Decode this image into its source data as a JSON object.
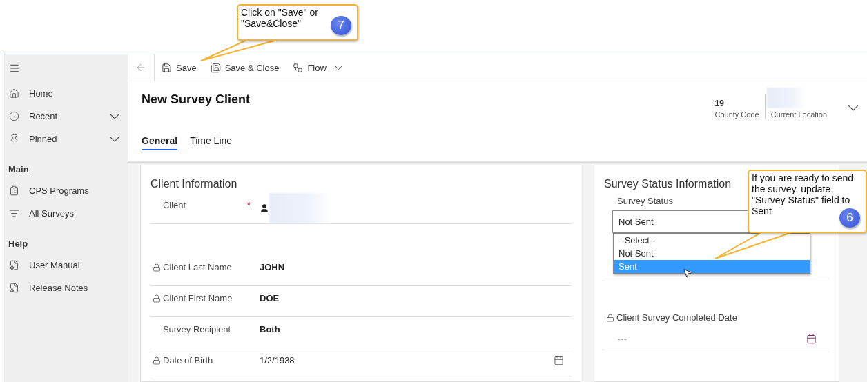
{
  "callouts": [
    {
      "text": "Click on \"Save\" or \"Save&Close\"",
      "step": "7"
    },
    {
      "text": "If you are ready to send the survey, update \"Survey Status\" field to Sent",
      "step": "6"
    }
  ],
  "sidebar": {
    "top_items": [
      {
        "label": "Home",
        "expandable": false
      },
      {
        "label": "Recent",
        "expandable": true
      },
      {
        "label": "Pinned",
        "expandable": true
      }
    ],
    "groups": [
      {
        "title": "Main",
        "items": [
          {
            "label": "CPS Programs"
          },
          {
            "label": "All Surveys"
          }
        ]
      },
      {
        "title": "Help",
        "items": [
          {
            "label": "User Manual"
          },
          {
            "label": "Release Notes"
          }
        ]
      }
    ]
  },
  "toolbar": {
    "buttons": [
      {
        "label": "Save",
        "dropdown": false
      },
      {
        "label": "Save & Close",
        "dropdown": false
      },
      {
        "label": "Flow",
        "dropdown": true
      }
    ]
  },
  "header": {
    "title": "New Survey Client",
    "fields": [
      {
        "value": "19",
        "label": "County Code"
      },
      {
        "label": "Current Location"
      }
    ]
  },
  "tabs": [
    {
      "label": "General",
      "selected": true
    },
    {
      "label": "Time Line",
      "selected": false
    }
  ],
  "client_section": {
    "title": "Client Information",
    "rows": [
      {
        "kind": "lookup",
        "label": "Client",
        "required_marker": "*",
        "locked": false
      },
      {
        "kind": "text",
        "label": "Client Last Name",
        "value": "JOHN",
        "locked": true
      },
      {
        "kind": "text",
        "label": "Client First Name",
        "value": "DOE",
        "locked": true
      },
      {
        "kind": "text",
        "label": "Survey Recipient",
        "value": "Both",
        "locked": false
      },
      {
        "kind": "date",
        "label": "Date of Birth",
        "value": "1/2/1938",
        "locked": true
      }
    ]
  },
  "status_section": {
    "title": "Survey Status Information",
    "status_field": {
      "label": "Survey Status",
      "value": "Not Sent",
      "options": [
        {
          "label": "--Select--",
          "highlighted": false
        },
        {
          "label": "Not Sent",
          "highlighted": false
        },
        {
          "label": "Sent",
          "highlighted": true
        }
      ]
    },
    "completed_field": {
      "label": "Client Survey Completed Date",
      "placeholder": "---",
      "locked": true
    }
  }
}
